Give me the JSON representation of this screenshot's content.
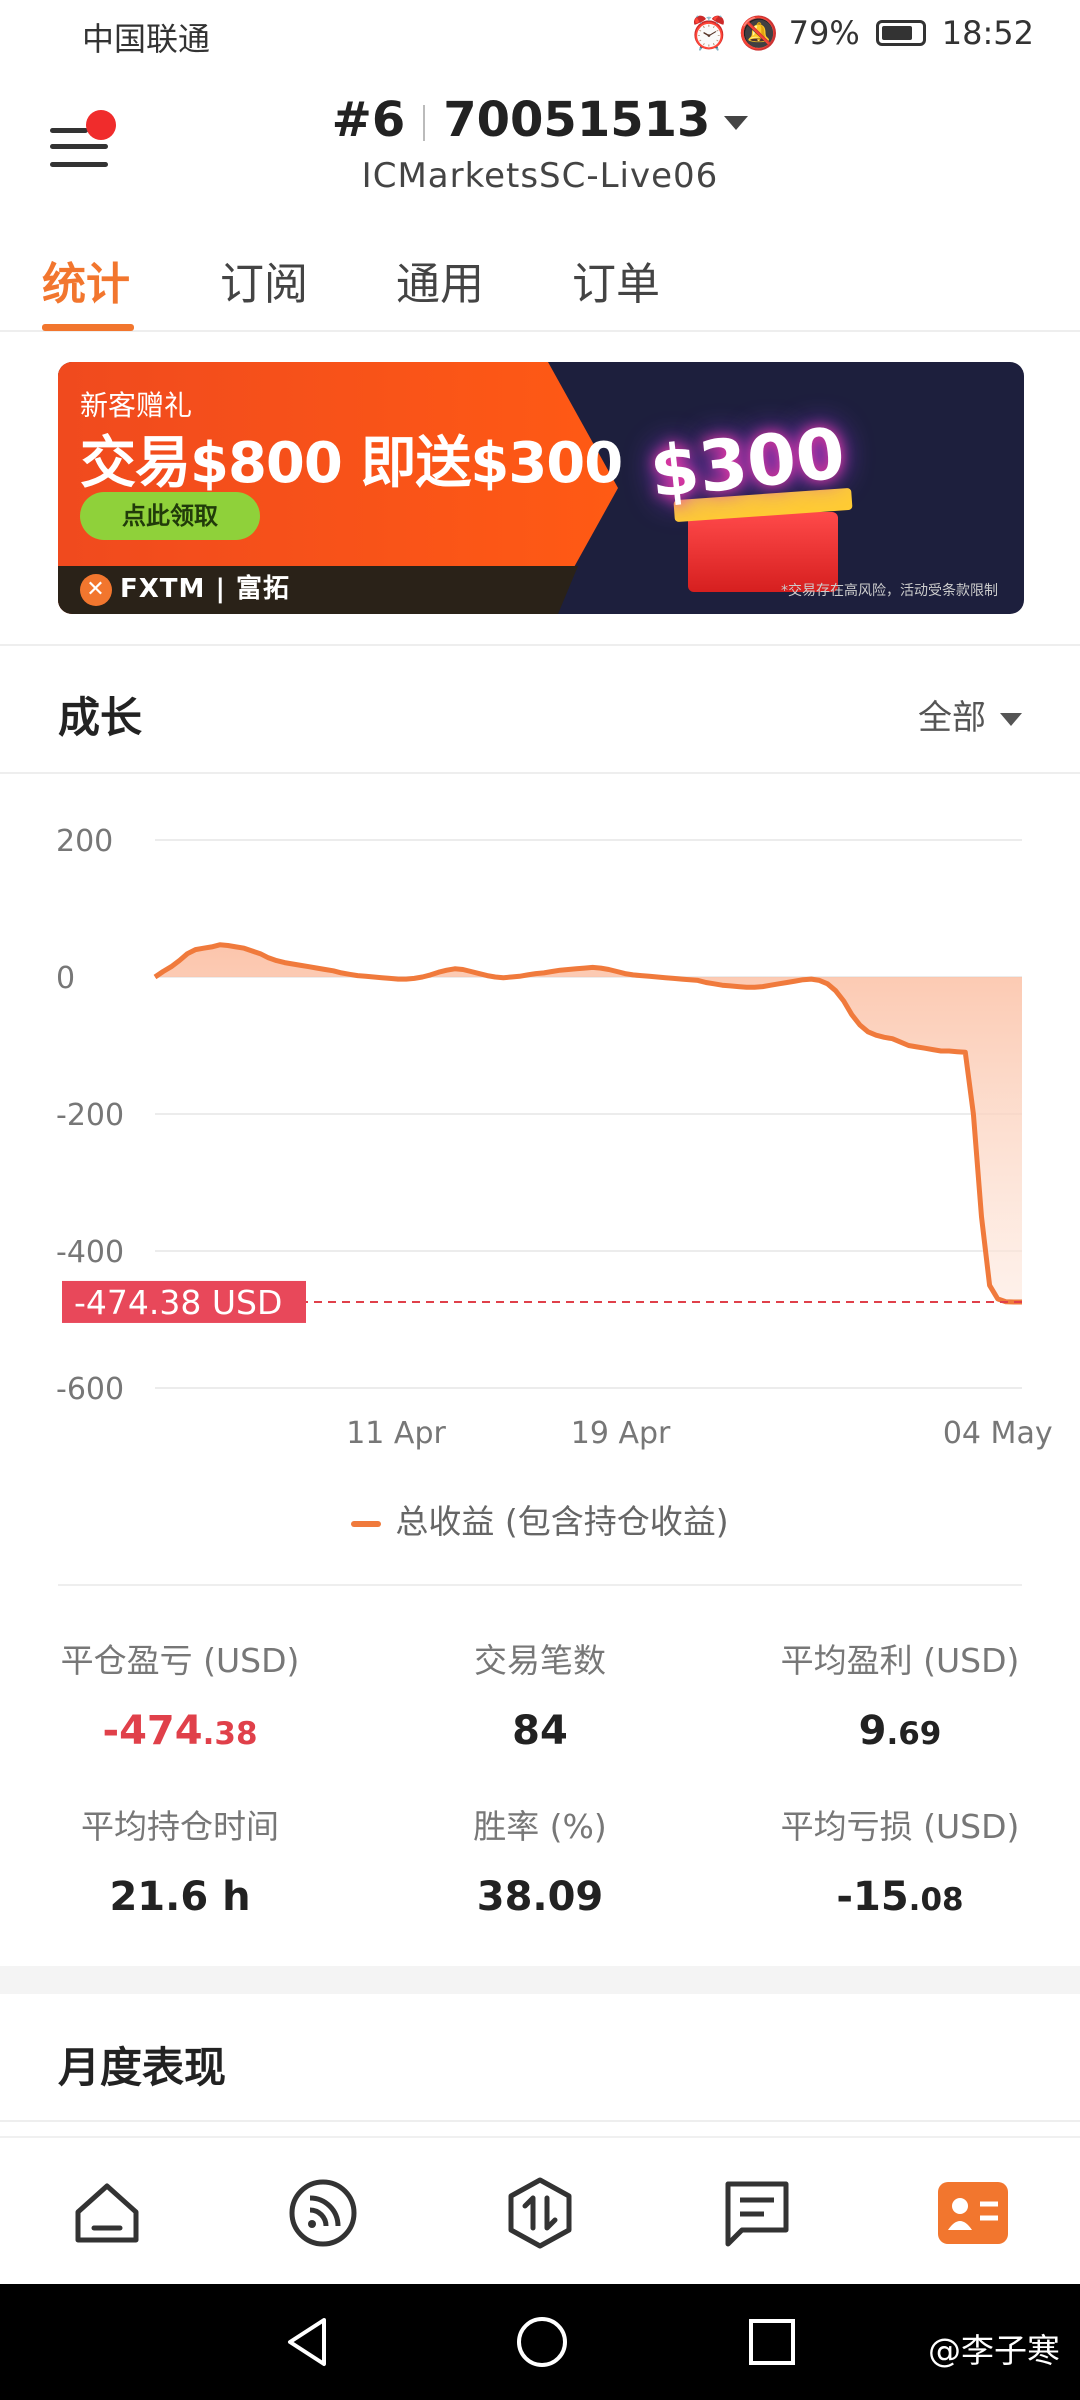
{
  "status_bar": {
    "carrier": "中国联通",
    "battery": "79%",
    "time": "18:52"
  },
  "header": {
    "account_index": "#6",
    "account_number": "70051513",
    "server": "ICMarketsSC-Live06"
  },
  "tabs": [
    {
      "label": "统计",
      "active": true
    },
    {
      "label": "订阅",
      "active": false
    },
    {
      "label": "通用",
      "active": false
    },
    {
      "label": "订单",
      "active": false
    }
  ],
  "banner": {
    "line1": "新客赠礼",
    "line2": "交易$800 即送$300",
    "cta": "点此领取",
    "brand": "FXTM | 富拓",
    "badge": "$300",
    "disclaimer": "*交易存在高风险，活动受条款限制"
  },
  "growth": {
    "title": "成长",
    "filter": "全部",
    "current_label": "-474.38 USD",
    "legend": "总收益 (包含持仓收益)"
  },
  "chart_data": {
    "type": "area",
    "title": "",
    "xlabel": "",
    "ylabel": "",
    "ylim": [
      -600,
      200
    ],
    "yticks": [
      200,
      0,
      -200,
      -400,
      -600
    ],
    "xtick_labels": [
      "11 Apr",
      "19 Apr",
      "04 May"
    ],
    "grid": true,
    "series": [
      {
        "name": "总收益 (包含持仓收益)",
        "color": "#f07a3c",
        "points": [
          0,
          8,
          15,
          24,
          34,
          40,
          42,
          44,
          47,
          46,
          44,
          42,
          38,
          34,
          28,
          24,
          21,
          19,
          17,
          15,
          13,
          11,
          9,
          6,
          4,
          2,
          1,
          0,
          -1,
          -2,
          -3,
          -3,
          -2,
          0,
          3,
          7,
          10,
          12,
          11,
          8,
          5,
          2,
          0,
          -1,
          0,
          1,
          3,
          5,
          6,
          8,
          10,
          11,
          12,
          13,
          14,
          13,
          11,
          8,
          5,
          3,
          2,
          1,
          0,
          -1,
          -2,
          -3,
          -4,
          -5,
          -8,
          -10,
          -12,
          -13,
          -14,
          -15,
          -15,
          -14,
          -12,
          -10,
          -8,
          -6,
          -4,
          -3,
          -5,
          -10,
          -20,
          -35,
          -55,
          -70,
          -80,
          -85,
          -88,
          -90,
          -95,
          -100,
          -102,
          -104,
          -106,
          -108,
          -108,
          -109,
          -110,
          -200,
          -350,
          -450,
          -470,
          -474,
          -474.38,
          -474.38
        ]
      }
    ],
    "reference_line": {
      "value": -474.38,
      "label": "-474.38 USD"
    }
  },
  "stats": [
    {
      "label": "平仓盈亏 (USD)",
      "int": "-474",
      "dec": ".38",
      "negative": true
    },
    {
      "label": "交易笔数",
      "int": "84",
      "dec": "",
      "negative": false
    },
    {
      "label": "平均盈利 (USD)",
      "int": "9",
      "dec": ".69",
      "negative": false
    },
    {
      "label": "平均持仓时间",
      "int": "21.6 h",
      "dec": "",
      "negative": false
    },
    {
      "label": "胜率 (%)",
      "int": "38.09",
      "dec": "",
      "negative": false
    },
    {
      "label": "平均亏损 (USD)",
      "int": "-15",
      "dec": ".08",
      "negative": false
    }
  ],
  "monthly": {
    "title": "月度表现"
  },
  "watermark": "@李子寒",
  "colors": {
    "accent": "#f2762e",
    "negative": "#e0404a",
    "line": "#f07a3c"
  }
}
